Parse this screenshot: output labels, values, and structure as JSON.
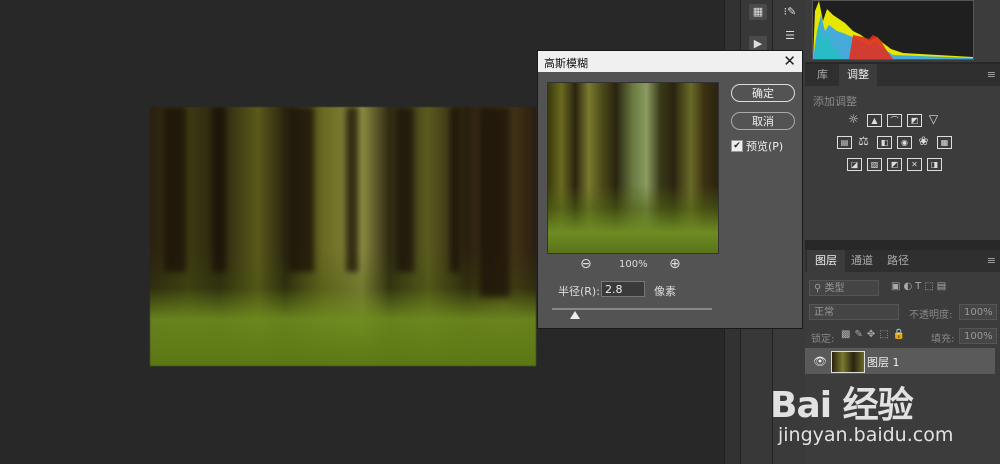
{
  "dialog": {
    "title": "高斯模糊",
    "ok_label": "确定",
    "cancel_label": "取消",
    "preview_label": "预览(P)",
    "preview_checked": true,
    "zoom_level": "100%",
    "radius_label": "半径(R):",
    "radius_value": "2.8",
    "radius_unit": "像素"
  },
  "adjust_panel": {
    "tabs": [
      "库",
      "调整"
    ],
    "active_tab": "调整",
    "subtitle": "添加调整"
  },
  "layers_panel": {
    "tabs": [
      "图层",
      "通道",
      "路径"
    ],
    "active_tab": "图层",
    "filter_label": "类型",
    "blend_mode": "正常",
    "opacity_label": "不透明度:",
    "opacity_value": "100%",
    "lock_label": "锁定:",
    "fill_label": "填充:",
    "fill_value": "100%",
    "layers": [
      {
        "name": "图层 1",
        "visible": true
      }
    ]
  },
  "watermark": {
    "brand": "Bai 经验",
    "url": "jingyan.baidu.com"
  }
}
